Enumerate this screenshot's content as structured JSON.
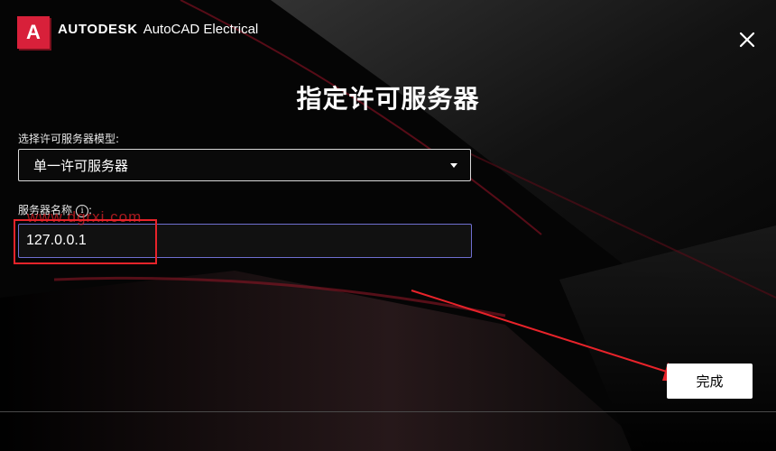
{
  "app": {
    "company": "AUTODESK",
    "product": "AutoCAD Electrical",
    "logo_letter": "A"
  },
  "dialog": {
    "title": "指定许可服务器",
    "model_label": "选择许可服务器模型:",
    "model_selected": "单一许可服务器",
    "server_name_label": "服务器名称",
    "server_name_label_suffix": ":",
    "server_name_value": "127.0.0.1",
    "finish_label": "完成"
  },
  "overlay": {
    "watermark": "www.dgrxi.com"
  },
  "icons": {
    "close": "close-icon",
    "info": "info-icon",
    "dropdown": "chevron-down-icon"
  },
  "colors": {
    "brand_red": "#d8203a",
    "annotation_red": "#e8232a",
    "input_border": "#6f6fd0"
  }
}
